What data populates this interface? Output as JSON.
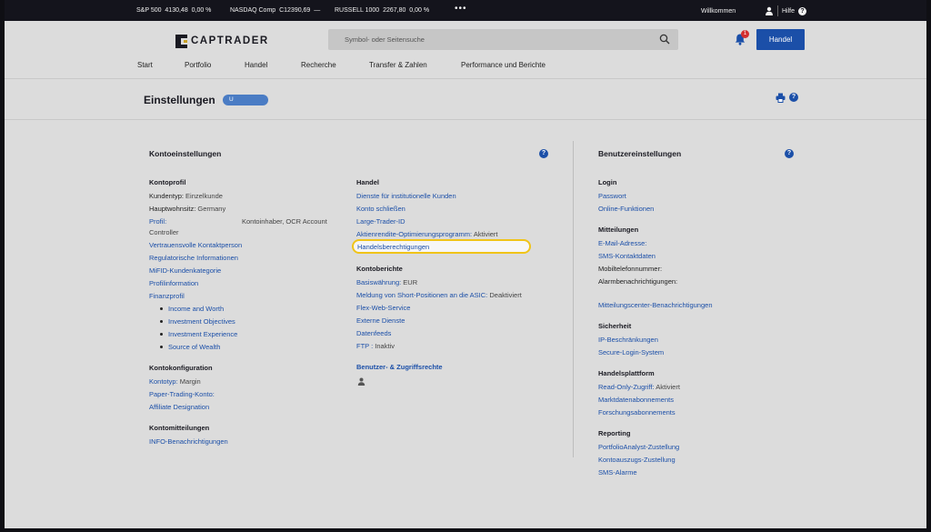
{
  "ticker": {
    "sp500_label": "S&P 500",
    "sp500_value": "4130,48",
    "sp500_change": "0,00 %",
    "nasdaq_label": "NASDAQ Comp",
    "nasdaq_value": "C12390,69",
    "nasdaq_change": "—",
    "russell_label": "RUSSELL 1000",
    "russell_value": "2267,80",
    "russell_change": "0,00 %",
    "more": "•••",
    "welcome": "Willkommen",
    "help": "Hilfe"
  },
  "header": {
    "logo": "CAPTRADER",
    "search_placeholder": "Symbol- oder Seitensuche",
    "notification_count": "1",
    "trade_button": "Handel",
    "nav": [
      "Start",
      "Portfolio",
      "Handel",
      "Recherche",
      "Transfer & Zahlen",
      "Performance und Berichte"
    ]
  },
  "page": {
    "title": "Einstellungen",
    "account_pill": "U"
  },
  "konto": {
    "title": "Kontoeinstellungen",
    "profil_title": "Kontoprofil",
    "kundentyp_label": "Kundentyp:",
    "kundentyp_value": "Einzelkunde",
    "wohnsitz_label": "Hauptwohnsitz:",
    "wohnsitz_value": "Germany",
    "profil_label": "Profil:",
    "profil_value": "Kontoinhaber, OCR Account",
    "profil_value2": "Controller",
    "links": [
      "Vertrauensvolle Kontaktperson",
      "Regulatorische Informationen",
      "MiFID-Kundenkategorie",
      "Profilinformation",
      "Finanzprofil"
    ],
    "finanz_sub": [
      "Income and Worth",
      "Investment Objectives",
      "Investment Experience",
      "Source of Wealth"
    ],
    "config_title": "Kontokonfiguration",
    "kontotyp_label": "Kontotyp:",
    "kontotyp_value": "Margin",
    "paper_label": "Paper-Trading-Konto:",
    "affiliate": "Affiliate Designation",
    "mitteil_title": "Kontomitteilungen",
    "info_notif": "INFO-Benachrichtigungen",
    "handel_title": "Handel",
    "handel_links": [
      "Dienste für institutionelle Kunden",
      "Konto schließen",
      "Large-Trader-ID"
    ],
    "aktien_label": "Aktienrendite-Optimierungsprogramm:",
    "aktien_value": "Aktiviert",
    "handels_berechtigungen": "Handelsberechtigungen",
    "berichte_title": "Kontoberichte",
    "basis_label": "Basiswährung:",
    "basis_value": "EUR",
    "short_label": "Meldung von Short-Positionen an die ASIC:",
    "short_value": "Deaktiviert",
    "berichte_links": [
      "Flex-Web-Service",
      "Externe Dienste",
      "Datenfeeds"
    ],
    "ftp_label": "FTP :",
    "ftp_value": "Inaktiv",
    "zugriff_title": "Benutzer- & Zugriffsrechte"
  },
  "benutzer": {
    "title": "Benutzereinstellungen",
    "login_title": "Login",
    "login_links": [
      "Passwort",
      "Online-Funktionen"
    ],
    "mitteil_title": "Mitteilungen",
    "mitteil_links": [
      "E-Mail-Adresse:",
      "SMS-Kontaktdaten"
    ],
    "mobil": "Mobiltelefonnummer:",
    "alarm": "Alarmbenachrichtigungen:",
    "center": "Mitteilungscenter-Benachrichtigungen",
    "sicher_title": "Sicherheit",
    "sicher_links": [
      "IP-Beschränkungen",
      "Secure-Login-System"
    ],
    "plattform_title": "Handelsplattform",
    "readonly_label": "Read-Only-Zugriff:",
    "readonly_value": "Aktiviert",
    "plattform_links": [
      "Marktdatenabonnements",
      "Forschungsabonnements"
    ],
    "reporting_title": "Reporting",
    "reporting_links": [
      "PortfolioAnalyst-Zustellung",
      "Kontoauszugs-Zustellung",
      "SMS-Alarme"
    ]
  },
  "colors": {
    "accent": "#1b4fa8",
    "highlight": "#f0c419",
    "badge": "#d32f2f"
  }
}
